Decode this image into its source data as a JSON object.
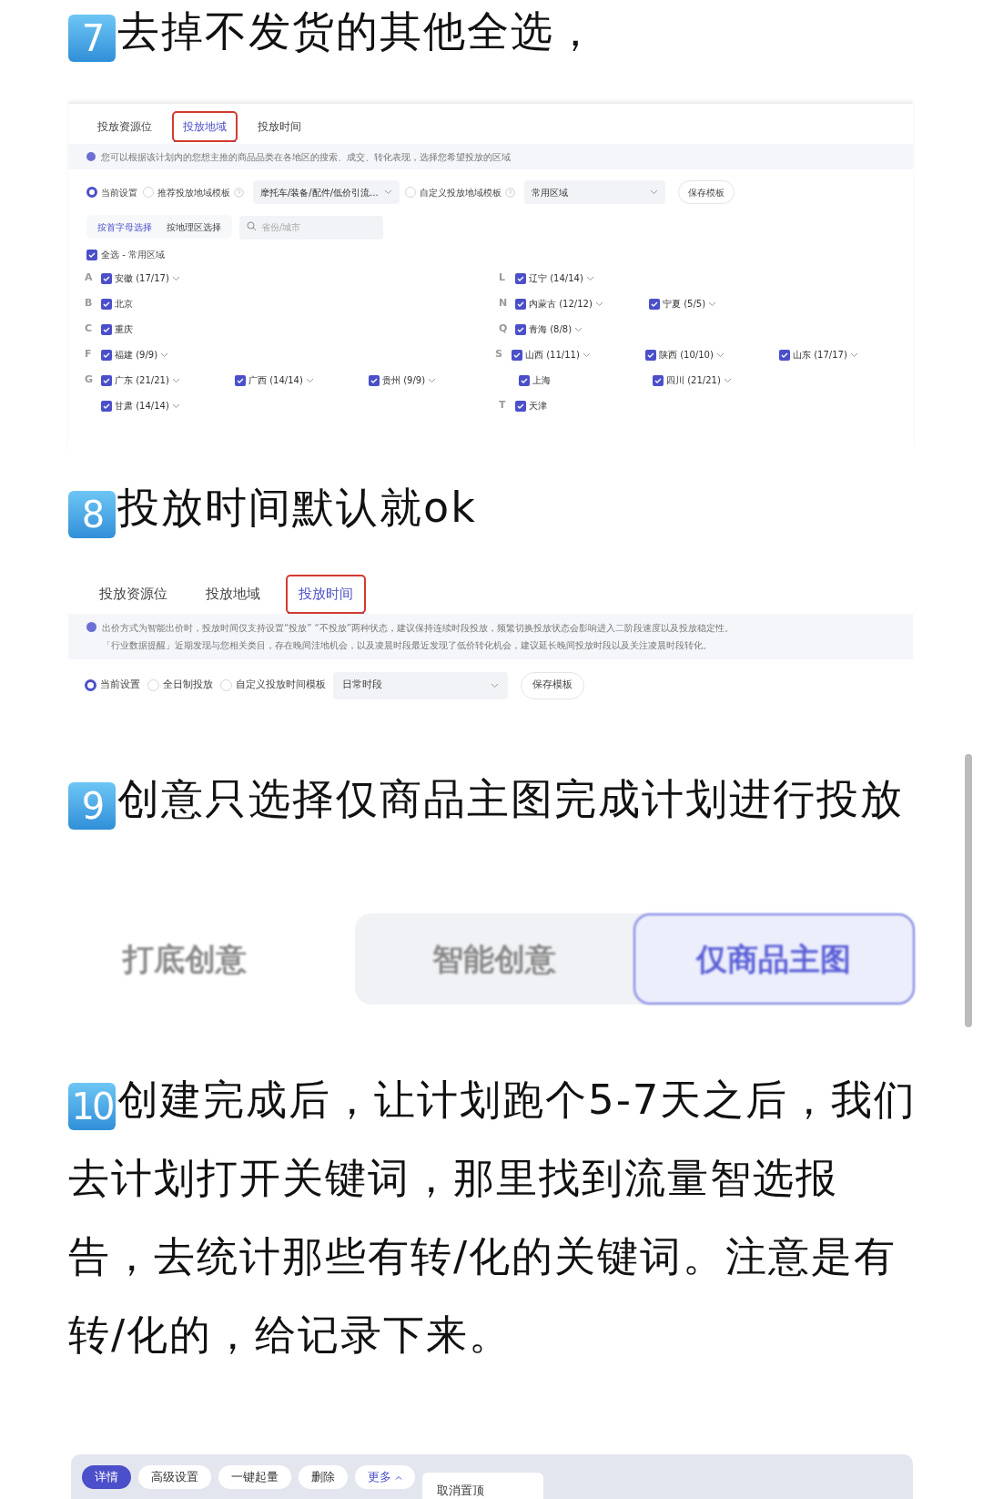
{
  "step7": {
    "badge": "7",
    "heading": "去掉不发货的其他全选，"
  },
  "region_panel": {
    "tabs": [
      {
        "label": "投放资源位",
        "selected": false,
        "boxed": false
      },
      {
        "label": "投放地域",
        "selected": true,
        "boxed": true
      },
      {
        "label": "投放时间",
        "selected": false,
        "boxed": false
      }
    ],
    "info": "您可以根据该计划内的您想主推的商品品类在各地区的搜索、成交、转化表现，选择您希望投放的区域",
    "options": [
      {
        "label": "当前设置",
        "selected": true,
        "help": false
      },
      {
        "label": "推荐投放地域模板",
        "selected": false,
        "help": true,
        "dropdown": "摩托车/装备/配件/低价引流..."
      },
      {
        "label": "自定义投放地域模板",
        "selected": false,
        "help": true,
        "dropdown": "常用区域"
      }
    ],
    "save_button": "保存模板",
    "filter_tabs": [
      {
        "label": "按首字母选择",
        "selected": true
      },
      {
        "label": "按地理区选择",
        "selected": false
      }
    ],
    "search": {
      "placeholder": "省份/城市"
    },
    "select_all": {
      "label": "全选 - 常用区域",
      "checked": true
    },
    "rows": [
      {
        "left": {
          "letter": "A",
          "provinces": [
            {
              "label": "安徽 (17/17)",
              "checked": true,
              "expandable": true
            }
          ]
        },
        "right": {
          "letter": "L",
          "provinces": [
            {
              "label": "辽宁 (14/14)",
              "checked": true,
              "expandable": true
            }
          ]
        }
      },
      {
        "left": {
          "letter": "B",
          "provinces": [
            {
              "label": "北京",
              "checked": true,
              "expandable": false
            }
          ]
        },
        "right": {
          "letter": "N",
          "provinces": [
            {
              "label": "内蒙古 (12/12)",
              "checked": true,
              "expandable": true
            },
            {
              "label": "宁夏 (5/5)",
              "checked": true,
              "expandable": true
            }
          ]
        }
      },
      {
        "left": {
          "letter": "C",
          "provinces": [
            {
              "label": "重庆",
              "checked": true,
              "expandable": false
            }
          ]
        },
        "right": {
          "letter": "Q",
          "provinces": [
            {
              "label": "青海 (8/8)",
              "checked": true,
              "expandable": true
            }
          ]
        }
      },
      {
        "left": {
          "letter": "F",
          "provinces": [
            {
              "label": "福建 (9/9)",
              "checked": true,
              "expandable": true
            }
          ]
        },
        "right": {
          "letter": "S",
          "provinces": [
            {
              "label": "山西 (11/11)",
              "checked": true,
              "expandable": true
            },
            {
              "label": "陕西 (10/10)",
              "checked": true,
              "expandable": true
            },
            {
              "label": "山东 (17/17)",
              "checked": true,
              "expandable": true
            }
          ]
        }
      },
      {
        "left": {
          "letter": "G",
          "provinces": [
            {
              "label": "广东 (21/21)",
              "checked": true,
              "expandable": true
            },
            {
              "label": "广西 (14/14)",
              "checked": true,
              "expandable": true
            },
            {
              "label": "贵州 (9/9)",
              "checked": true,
              "expandable": true
            }
          ]
        },
        "right": {
          "provinces": [
            {
              "label": "上海",
              "checked": true,
              "expandable": false
            },
            {
              "label": "四川 (21/21)",
              "checked": true,
              "expandable": true
            }
          ]
        }
      },
      {
        "left": {
          "provinces": [
            {
              "label": "甘肃 (14/14)",
              "checked": true,
              "expandable": true
            }
          ]
        },
        "right": {
          "letter": "T",
          "provinces": [
            {
              "label": "天津",
              "checked": true,
              "expandable": false
            }
          ]
        }
      }
    ]
  },
  "step8": {
    "badge": "8",
    "heading": "投放时间默认就ok"
  },
  "time_panel": {
    "tabs": [
      {
        "label": "投放资源位",
        "selected": false,
        "boxed": false
      },
      {
        "label": "投放地域",
        "selected": false,
        "boxed": false
      },
      {
        "label": "投放时间",
        "selected": true,
        "boxed": true
      }
    ],
    "info": [
      "出价方式为智能出价时，投放时间仅支持设置“投放” “不投放”两种状态，建议保持连续时段投放，频繁切换投放状态会影响进入二阶段速度以及投放稳定性。",
      "「行业数据提醒」近期发现与您相关类目，存在晚间洼地机会，以及凌晨时段最近发现了低价转化机会，建议延长晚间投放时段以及关注凌晨时段转化。"
    ],
    "options": [
      {
        "label": "当前设置",
        "selected": true
      },
      {
        "label": "全日制投放",
        "selected": false
      },
      {
        "label": "自定义投放时间模板",
        "selected": false
      }
    ],
    "dropdown": "日常时段",
    "save_button": "保存模板"
  },
  "step9": {
    "badge": "9",
    "heading": "创意只选择仅商品主图完成计划进行投放"
  },
  "creative": {
    "label": "打底创意",
    "segments": [
      {
        "label": "智能创意",
        "selected": false
      },
      {
        "label": "仅商品主图",
        "selected": true
      }
    ]
  },
  "step10": {
    "badge": "10",
    "paragraph": "创建完成后，让计划跑个5-7天之后，我们去计划打开关键词，那里找到流量智选报告，去统计那些有转/化的关键词。注意是有转/化的，给记录下来。"
  },
  "toolbar": {
    "buttons": [
      {
        "label": "详情",
        "selected": true,
        "kind": "plain"
      },
      {
        "label": "高级设置",
        "selected": false,
        "kind": "plain"
      },
      {
        "label": "一键起量",
        "selected": false,
        "kind": "plain"
      },
      {
        "label": "删除",
        "selected": false,
        "kind": "plain"
      },
      {
        "label": "更多",
        "selected": false,
        "kind": "menu"
      }
    ],
    "menu_items": [
      "取消置顶"
    ]
  }
}
